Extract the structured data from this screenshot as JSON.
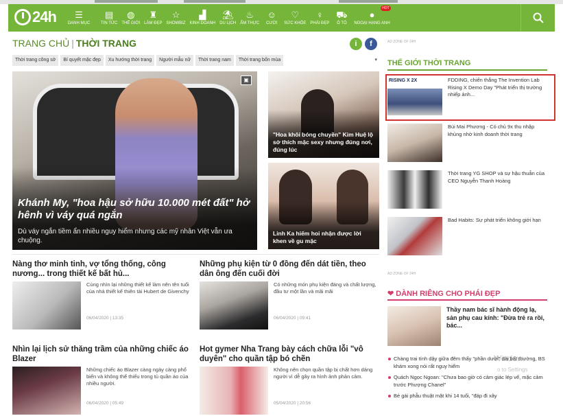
{
  "nav": {
    "logo": "24h",
    "items": [
      {
        "icon": "menu-icon",
        "glyph": "☰",
        "label": "DANH MỤC"
      },
      {
        "icon": "news-icon",
        "glyph": "▤",
        "label": "TIN TỨC"
      },
      {
        "icon": "globe-icon",
        "glyph": "◍",
        "label": "THẾ GIỚI"
      },
      {
        "icon": "lipstick-icon",
        "glyph": "♜",
        "label": "LÀM ĐẸP"
      },
      {
        "icon": "star-icon",
        "glyph": "☆",
        "label": "SHOWBIZ"
      },
      {
        "icon": "chart-icon",
        "glyph": "▟",
        "label": "KINH DOANH"
      },
      {
        "icon": "travel-icon",
        "glyph": "⛱",
        "label": "DU LỊCH"
      },
      {
        "icon": "food-icon",
        "glyph": "♨",
        "label": "ẨM THỰC"
      },
      {
        "icon": "smile-icon",
        "glyph": "☺",
        "label": "CƯỜI"
      },
      {
        "icon": "heart-icon",
        "glyph": "♡",
        "label": "SỨC KHỎE"
      },
      {
        "icon": "woman-icon",
        "glyph": "♀",
        "label": "PHÁI ĐẸP"
      },
      {
        "icon": "car-icon",
        "glyph": "⛟",
        "label": "Ô TÔ"
      },
      {
        "icon": "water-drop-icon",
        "glyph": "●",
        "label": "NGOẠI HẠNG ANH",
        "badge": "HOT"
      }
    ],
    "search_icon": "search-icon"
  },
  "breadcrumb": {
    "home": "TRANG CHỦ",
    "current": "THỜI TRANG"
  },
  "subtabs": [
    "Thời trang công sở",
    "Bí quyết mặc đẹp",
    "Xu hướng thời trang",
    "Người mẫu nữ",
    "Thời trang nam",
    "Thời trang bốn mùa"
  ],
  "subtabs_more": "▾",
  "hero": {
    "title": "Khánh My, \"hoa hậu sở hữu 10.000 mét đất\" hở hênh vì váy quá ngắn",
    "desc": "Dù váy ngắn tiềm ẩn nhiều nguy hiểm nhưng các mỹ nhân Việt vẫn ưa chuộng."
  },
  "side_cards": [
    {
      "title": "\"Hoa khôi bóng chuyền\" Kim Huệ lộ sở thích mặc sexy nhưng đúng nơi, đúng lúc"
    },
    {
      "title": "Linh Ka hiếm hoi nhận được lời khen về gu mặc"
    }
  ],
  "articles": [
    {
      "title": "Nàng thơ minh tinh, vợ tổng thống, công nương... trong thiết kế bất hủ...",
      "desc": "Cùng nhìn lại những thiết kế làm nên tên tuổi của nhà thiết kế thiên tài Hubert de Givenchy",
      "date": "06/04/2020 | 13:35"
    },
    {
      "title": "Những phụ kiện từ 0 đồng đến dát tiền, theo dân ông đến cuối đời",
      "desc": "Có những món phụ kiện đáng và chất lượng, đầu tư một lần và mãi mãi",
      "date": "06/04/2020 | 09:41"
    },
    {
      "title": "Nhìn lại lịch sử thăng trầm của những chiếc áo Blazer",
      "desc": "Những chiếc áo Blazer càng ngày càng phổ biến và không thể thiếu trong tủ quần áo của nhiều người.",
      "date": "06/04/2020 | 05:49"
    },
    {
      "title": "Hot gymer Nha Trang bày cách chữa lỗi \"vô duyên\" cho quần tập bó chẽn",
      "desc": "Không nên chọn quần tập bị chất hơn dáng người vì dễ gây ra hình ảnh phản cảm.",
      "date": "05/04/2020 | 20:56"
    }
  ],
  "right": {
    "adzone1": "AD ZONE OF 24H",
    "sect1": "THẾ GIỚI THỜI TRANG",
    "news": [
      {
        "text": "FDDING, chiến thắng The Invention Lab Rising X Demo Day \"Phát triển thị trường nhiếp ảnh...",
        "thumb_text": "RISING X 2X"
      },
      {
        "text": "Bùi Mai Phương - Có chủ 9x thu nhập khủng nhờ kinh doanh thời trang"
      },
      {
        "text": "Thời trang YG SHOP và sự hậu thuẫn của CEO Nguyễn Thanh Hoàng"
      },
      {
        "text": "Bad Habits: Sự phát triển không giới hạn"
      }
    ],
    "adzone2": "AD ZONE OF 24H",
    "sect2": "DÀNH RIÊNG CHO PHÁI ĐẸP",
    "sect2_icon": "heart-icon",
    "pink_top": "Thầy nam bác sĩ hành động lạ, sản phụ cau kính: \"Đừa trẻ ra rồi, bác...",
    "bullets": [
      "Chàng trai tính dậy giữa đêm thấy \"phần dưới\" dài bất thường, BS khám xong nói rất nguy hiểm",
      "Quách Ngọc Ngoan: \"Chưa bao giờ có cảm giác lép vế, mặc cảm trước Phượng Chanel\"",
      "Bé gái phẫu thuật mặt khi 14 tuổi, \"đáp đi xây"
    ],
    "watermark": "Window",
    "watermark2": "o to Settings"
  },
  "colors": {
    "brand_green": "#75b53a",
    "pink": "#d23d6b",
    "highlight_red": "#d0332f"
  }
}
